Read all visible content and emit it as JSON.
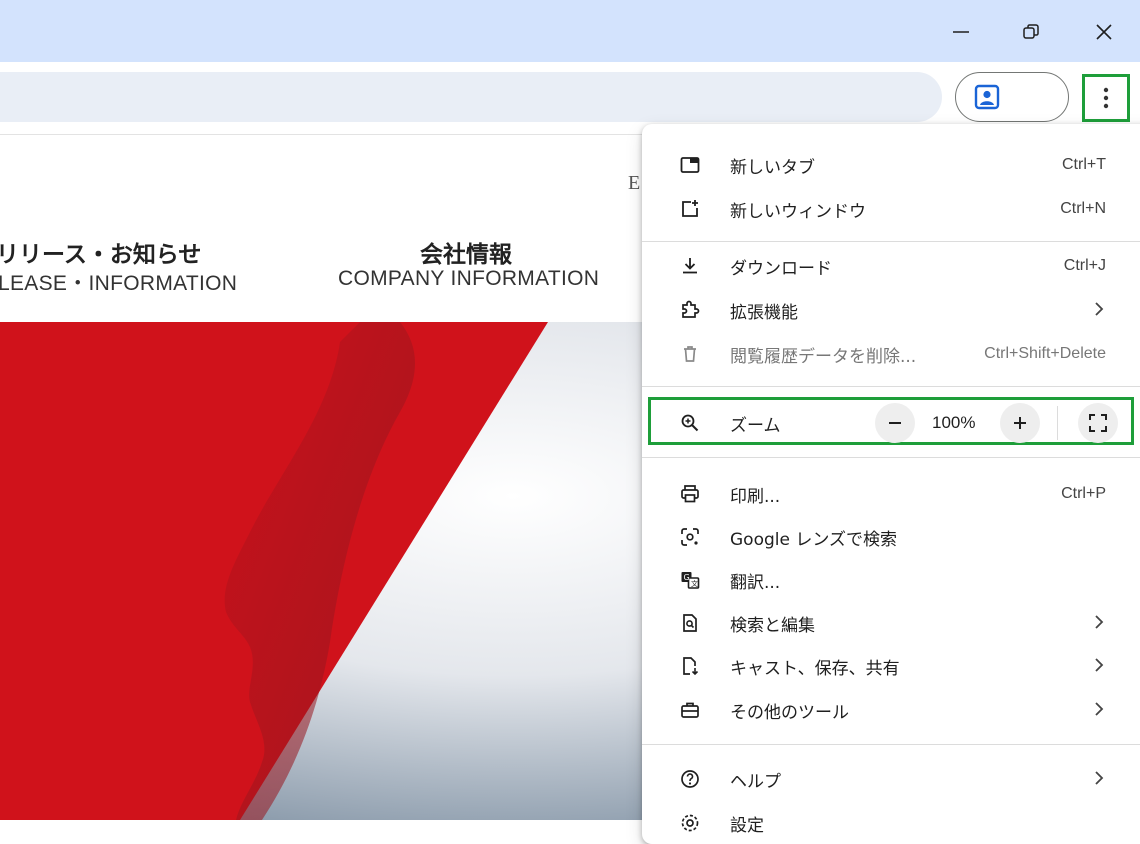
{
  "window": {
    "controls": [
      "minimize-icon",
      "restore-icon",
      "close-icon"
    ]
  },
  "page": {
    "partial_letter": "E",
    "nav": [
      {
        "title": "リリース・お知らせ",
        "subtitle": "LEASE・INFORMATION"
      },
      {
        "title": "会社情報",
        "subtitle": "COMPANY INFORMATION"
      }
    ],
    "hero_colors": {
      "red": "#d0121b",
      "sky": "#cfd6df"
    }
  },
  "menu": {
    "items": [
      {
        "label": "新しいタブ",
        "shortcut": "Ctrl+T",
        "icon": "new-tab-icon"
      },
      {
        "label": "新しいウィンドウ",
        "shortcut": "Ctrl+N",
        "icon": "new-window-icon"
      },
      {
        "label": "ダウンロード",
        "shortcut": "Ctrl+J",
        "icon": "download-icon"
      },
      {
        "label": "拡張機能",
        "icon": "extensions-icon",
        "submenu": true
      },
      {
        "label": "閲覧履歴データを削除...",
        "shortcut": "Ctrl+Shift+Delete",
        "icon": "trash-icon",
        "disabled": true
      },
      {
        "label": "印刷...",
        "shortcut": "Ctrl+P",
        "icon": "print-icon"
      },
      {
        "label": "Google レンズで検索",
        "icon": "lens-icon"
      },
      {
        "label": "翻訳...",
        "icon": "translate-icon"
      },
      {
        "label": "検索と編集",
        "icon": "find-edit-icon",
        "submenu": true
      },
      {
        "label": "キャスト、保存、共有",
        "icon": "cast-save-share-icon",
        "submenu": true
      },
      {
        "label": "その他のツール",
        "icon": "toolbox-icon",
        "submenu": true
      },
      {
        "label": "ヘルプ",
        "icon": "help-icon",
        "submenu": true
      },
      {
        "label": "設定",
        "icon": "settings-icon"
      }
    ],
    "zoom": {
      "label": "ズーム",
      "value": "100%",
      "minus": "−",
      "plus": "+"
    }
  },
  "colors": {
    "titlebar": "#d3e3fd",
    "highlight_box": "#1e9e3a",
    "omnibox": "#e9eef6"
  }
}
